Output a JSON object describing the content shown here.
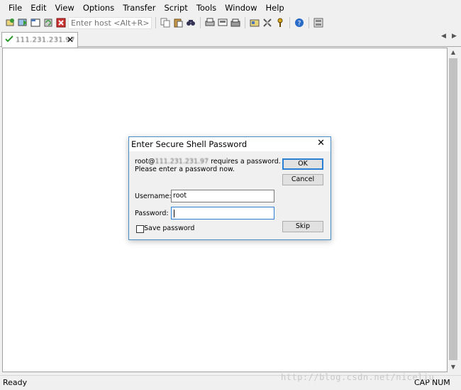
{
  "menu": [
    "File",
    "Edit",
    "View",
    "Options",
    "Transfer",
    "Script",
    "Tools",
    "Window",
    "Help"
  ],
  "toolbar": {
    "host_placeholder": "Enter host <Alt+R>",
    "icons_left": [
      "connect-icon",
      "quick-connect-icon",
      "connect-in-tab-icon",
      "reconnect-icon",
      "disconnect-icon"
    ],
    "icons_right": [
      "copy-icon",
      "paste-icon",
      "find-icon",
      "print-icon",
      "print-screen-icon",
      "print-setup-icon",
      "session-options-icon",
      "global-options-icon",
      "keymap-icon",
      "help-icon",
      "sftp-icon"
    ]
  },
  "tab": {
    "title": "111.231.231.97",
    "status_icon": "check-icon"
  },
  "dialog": {
    "title": "Enter Secure Shell Password",
    "msg_prefix": "root@",
    "msg_host": "111.231.231.97",
    "msg_suffix": " requires a password.",
    "msg_line2": "Please enter a password now.",
    "username_label": "Username:",
    "username_value": "root",
    "password_label": "Password:",
    "password_value": "",
    "save_password_label": "Save password",
    "save_password_checked": false,
    "ok_label": "OK",
    "cancel_label": "Cancel",
    "skip_label": "Skip"
  },
  "status": {
    "text": "Ready",
    "cap": "CAP",
    "num": "NUM"
  },
  "watermark": "http://blog.csdn.net/niceliu"
}
